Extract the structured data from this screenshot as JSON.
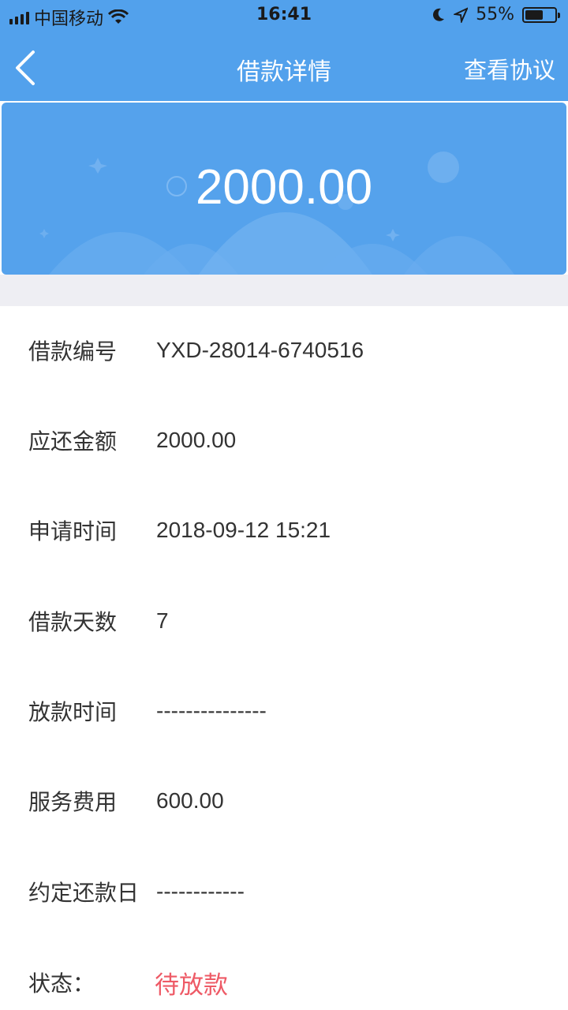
{
  "status_bar": {
    "carrier": "中国移动",
    "time": "16:41",
    "battery": "55%"
  },
  "navbar": {
    "title": "借款详情",
    "agreement_label": "查看协议"
  },
  "hero": {
    "amount": "2000.00"
  },
  "details": [
    {
      "label": "借款编号",
      "value": "YXD-28014-6740516"
    },
    {
      "label": "应还金额",
      "value": "2000.00"
    },
    {
      "label": "申请时间",
      "value": "2018-09-12 15:21"
    },
    {
      "label": "借款天数",
      "value": "7"
    },
    {
      "label": "放款时间",
      "value": "---------------"
    },
    {
      "label": "服务费用",
      "value": "600.00"
    },
    {
      "label": "约定还款日",
      "value": "------------"
    }
  ],
  "loan_status": {
    "label": "状态：",
    "value": "待放款"
  },
  "colors": {
    "primary": "#52a1ec",
    "status_red": "#ee5a66",
    "divider_bg": "#eeeef3"
  }
}
